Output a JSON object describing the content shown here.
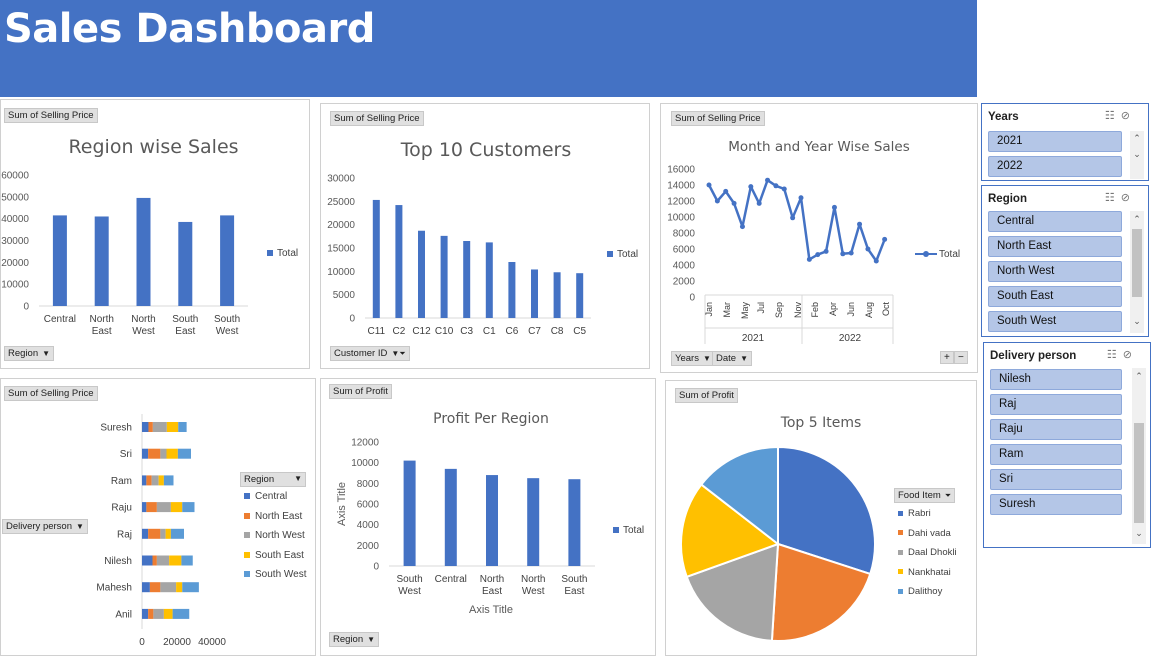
{
  "title": "Sales Dashboard",
  "colors": {
    "banner": "#4472c4",
    "bar": "#4472c4",
    "orange": "#ed7d31",
    "gray": "#a5a5a5",
    "yellow": "#ffc000",
    "lightblue": "#5b9bd5"
  },
  "region_sales": {
    "value_button": "Sum of Selling Price",
    "filter_button": "Region",
    "title": "Region wise Sales",
    "legend": "Total",
    "y_ticks": [
      "60000",
      "50000",
      "40000",
      "30000",
      "20000",
      "10000",
      "0"
    ],
    "chart_data": {
      "type": "bar",
      "categories": [
        [
          "Central"
        ],
        [
          "North",
          "East"
        ],
        [
          "North",
          "West"
        ],
        [
          "South",
          "East"
        ],
        [
          "South",
          "West"
        ]
      ],
      "values": [
        41500,
        41000,
        49500,
        38500,
        41500
      ],
      "ylim": [
        0,
        60000
      ]
    }
  },
  "top_customers": {
    "value_button": "Sum of Selling Price",
    "filter_button": "Customer ID",
    "title": "Top 10 Customers",
    "legend": "Total",
    "y_ticks": [
      "30000",
      "25000",
      "20000",
      "15000",
      "10000",
      "5000",
      "0"
    ],
    "chart_data": {
      "type": "bar",
      "categories": [
        "C11",
        "C2",
        "C12",
        "C10",
        "C3",
        "C1",
        "C6",
        "C7",
        "C8",
        "C5"
      ],
      "values": [
        25300,
        24200,
        18700,
        17600,
        16500,
        16200,
        12000,
        10400,
        9800,
        9600
      ],
      "ylim": [
        0,
        30000
      ]
    }
  },
  "month_year": {
    "value_button": "Sum of Selling Price",
    "filter_years": "Years",
    "filter_date": "Date",
    "title": "Month and Year Wise Sales",
    "legend": "Total",
    "y_ticks": [
      "16000",
      "14000",
      "12000",
      "10000",
      "8000",
      "6000",
      "4000",
      "2000",
      "0"
    ],
    "month_labels": [
      "Jan",
      "Mar",
      "May",
      "Jul",
      "Sep",
      "Nov",
      "Feb",
      "Apr",
      "Jun",
      "Aug",
      "Oct"
    ],
    "year_labels": [
      "2021",
      "2022"
    ],
    "zoom_plus": "+",
    "zoom_minus": "−",
    "chart_data": {
      "type": "line",
      "x": [
        "2021-Jan",
        "2021-Feb",
        "2021-Mar",
        "2021-Apr",
        "2021-May",
        "2021-Jun",
        "2021-Jul",
        "2021-Aug",
        "2021-Sep",
        "2021-Oct",
        "2021-Nov",
        "2021-Dec",
        "2022-Jan",
        "2022-Feb",
        "2022-Mar",
        "2022-Apr",
        "2022-May",
        "2022-Jun",
        "2022-Jul",
        "2022-Aug",
        "2022-Sep",
        "2022-Oct",
        "2022-Nov"
      ],
      "values": [
        14000,
        12000,
        13200,
        11700,
        8800,
        13800,
        11700,
        14600,
        13900,
        13500,
        9900,
        12400,
        4700,
        5300,
        5700,
        11200,
        5400,
        5500,
        9100,
        6000,
        4500,
        7200,
        null
      ],
      "ylim": [
        0,
        16000
      ]
    }
  },
  "delivery_person_chart": {
    "value_button": "Sum of Selling Price",
    "filter_button": "Delivery person",
    "legend_button": "Region",
    "x_ticks": [
      "0",
      "20000",
      "40000"
    ],
    "chart_data": {
      "type": "bar",
      "orientation": "horizontal",
      "stacked": true,
      "categories": [
        "Suresh",
        "Sri",
        "Ram",
        "Raju",
        "Raj",
        "Nilesh",
        "Mahesh",
        "Anil"
      ],
      "series": [
        {
          "name": "Central",
          "values": [
            3700,
            3500,
            2500,
            2500,
            3500,
            6000,
            4500,
            3500
          ]
        },
        {
          "name": "North East",
          "values": [
            2500,
            7000,
            3000,
            6000,
            7000,
            2500,
            6000,
            3000
          ]
        },
        {
          "name": "North West",
          "values": [
            8000,
            3500,
            4000,
            8000,
            3000,
            7000,
            9000,
            6000
          ]
        },
        {
          "name": "South East",
          "values": [
            6500,
            6500,
            3000,
            6500,
            3000,
            7000,
            3500,
            5000
          ]
        },
        {
          "name": "South West",
          "values": [
            4800,
            7500,
            5500,
            7000,
            7500,
            6500,
            9500,
            9500
          ]
        }
      ],
      "xlim": [
        0,
        40000
      ]
    }
  },
  "profit_region": {
    "value_button": "Sum of Profit",
    "filter_button": "Region",
    "title": "Profit Per Region",
    "legend": "Total",
    "xlabel": "Axis Title",
    "ylabel": "Axis Title",
    "y_ticks": [
      "12000",
      "10000",
      "8000",
      "6000",
      "4000",
      "2000",
      "0"
    ],
    "chart_data": {
      "type": "bar",
      "categories": [
        [
          "South",
          "West"
        ],
        [
          "Central"
        ],
        [
          "North",
          "East"
        ],
        [
          "North",
          "West"
        ],
        [
          "South",
          "East"
        ]
      ],
      "values": [
        10200,
        9400,
        8800,
        8500,
        8400
      ],
      "ylim": [
        0,
        12000
      ]
    }
  },
  "top_items": {
    "value_button": "Sum of Profit",
    "legend_button": "Food Item",
    "title": "Top 5 Items",
    "chart_data": {
      "type": "pie",
      "labels": [
        "Rabri",
        "Dahi vada",
        "Daal Dhokli",
        "Nankhatai",
        "Dalithoy"
      ],
      "values": [
        30,
        21,
        18.5,
        16,
        14.5
      ],
      "colors": [
        "#4472c4",
        "#ed7d31",
        "#a5a5a5",
        "#ffc000",
        "#5b9bd5"
      ]
    }
  },
  "slicers": {
    "years": {
      "header": "Years",
      "items": [
        "2021",
        "2022"
      ]
    },
    "region": {
      "header": "Region",
      "items": [
        "Central",
        "North East",
        "North West",
        "South East",
        "South West"
      ]
    },
    "delivery": {
      "header": "Delivery person",
      "items": [
        "Nilesh",
        "Raj",
        "Raju",
        "Ram",
        "Sri",
        "Suresh"
      ]
    }
  }
}
